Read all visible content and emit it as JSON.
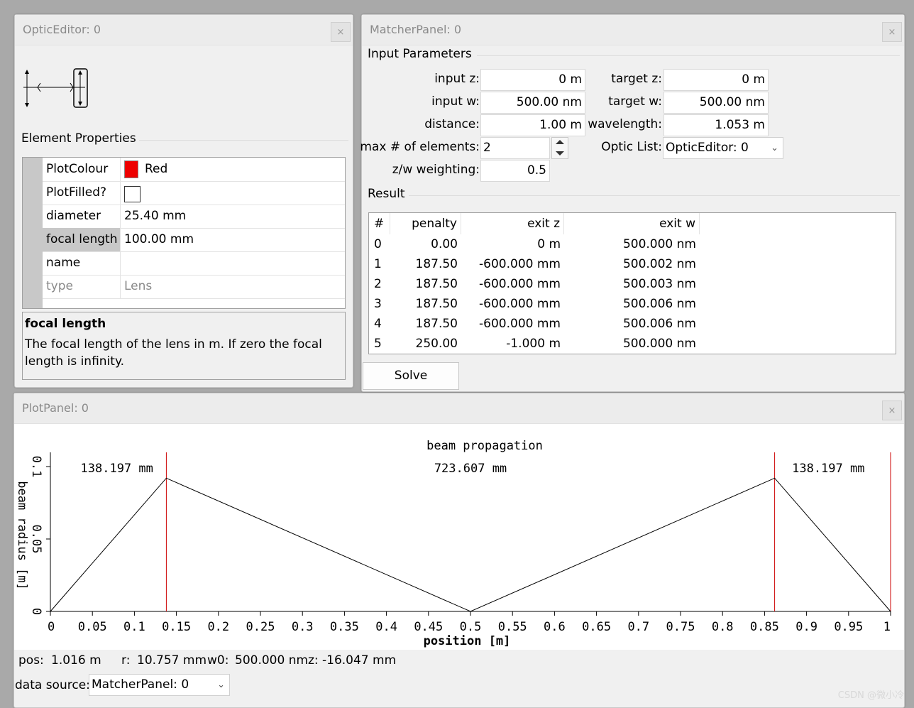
{
  "optic_editor": {
    "title": "OpticEditor: 0",
    "close": "×",
    "section_label": "Element Properties",
    "properties": [
      {
        "name": "PlotColour",
        "value": "Red",
        "kind": "colour",
        "color": "#ee0000"
      },
      {
        "name": "PlotFilled?",
        "value": "",
        "kind": "checkbox"
      },
      {
        "name": "diameter",
        "value": "25.40 mm",
        "kind": "text"
      },
      {
        "name": "focal length",
        "value": "100.00 mm",
        "kind": "text",
        "selected": true
      },
      {
        "name": "name",
        "value": "",
        "kind": "text"
      },
      {
        "name": "type",
        "value": "Lens",
        "kind": "readonly"
      }
    ],
    "help_title": "focal length",
    "help_text": "The focal length of the lens in m. If zero the focal length is infinity."
  },
  "matcher_panel": {
    "title": "MatcherPanel: 0",
    "close": "×",
    "input_section": "Input Parameters",
    "input_z_label": "input z:",
    "input_z": "0 m",
    "input_w_label": "input w:",
    "input_w": "500.00 nm",
    "distance_label": "distance:",
    "distance": "1.00 m",
    "max_elements_label": "max # of elements:",
    "max_elements": "2",
    "zw_weighting_label": "z/w weighting:",
    "zw_weighting": "0.5",
    "target_z_label": "target z:",
    "target_z": "0 m",
    "target_w_label": "target w:",
    "target_w": "500.00 nm",
    "wavelength_label": "wavelength:",
    "wavelength": "1.053 m",
    "optic_list_label": "Optic List:",
    "optic_list_value": "OpticEditor: 0",
    "result_section": "Result",
    "columns": [
      "#",
      "penalty",
      "exit z",
      "exit w"
    ],
    "rows": [
      [
        "0",
        "0.00",
        "0 m",
        "500.000 nm"
      ],
      [
        "1",
        "187.50",
        "-600.000 mm",
        "500.002 nm"
      ],
      [
        "2",
        "187.50",
        "-600.000 mm",
        "500.003 nm"
      ],
      [
        "3",
        "187.50",
        "-600.000 mm",
        "500.006 nm"
      ],
      [
        "4",
        "187.50",
        "-600.000 mm",
        "500.006 nm"
      ],
      [
        "5",
        "250.00",
        "-1.000 m",
        "500.000 nm"
      ]
    ],
    "solve_label": "Solve"
  },
  "plot_panel": {
    "title": "PlotPanel: 0",
    "close": "×",
    "status": {
      "pos_label": "pos:",
      "pos_value": "1.016 m",
      "r_label": "r:",
      "r_value": "10.757 mm",
      "w0_label": "w0:",
      "w0_value": "500.000 nm",
      "z_label": "z:",
      "z_value": "-16.047 mm"
    },
    "data_source_label": "data source:",
    "data_source_value": "MatcherPanel: 0"
  },
  "chart_data": {
    "type": "line",
    "title": "beam propagation",
    "xlabel": "position [m]",
    "ylabel": "beam radius [m]",
    "xlim": [
      0,
      1
    ],
    "ylim": [
      0,
      0.1
    ],
    "x_ticks": [
      "0",
      "0.05",
      "0.1",
      "0.15",
      "0.2",
      "0.25",
      "0.3",
      "0.35",
      "0.4",
      "0.45",
      "0.5",
      "0.55",
      "0.6",
      "0.65",
      "0.7",
      "0.75",
      "0.8",
      "0.85",
      "0.9",
      "0.95",
      "1"
    ],
    "y_ticks": [
      "0",
      "0.05",
      "0.1"
    ],
    "series": [
      {
        "x": [
          0,
          0.138,
          0.5,
          0.862,
          1.0
        ],
        "y": [
          0,
          0.092,
          0,
          0.092,
          0
        ],
        "color": "#000000"
      }
    ],
    "element_lines": {
      "x": [
        0.138,
        0.862,
        1.0
      ],
      "color": "#cc0000"
    },
    "segment_labels": [
      {
        "text": "138.197 mm",
        "x": 0.069
      },
      {
        "text": "723.607 mm",
        "x": 0.5
      },
      {
        "text": "138.197 mm",
        "x": 0.931
      }
    ]
  },
  "watermark": "CSDN @微小冷"
}
